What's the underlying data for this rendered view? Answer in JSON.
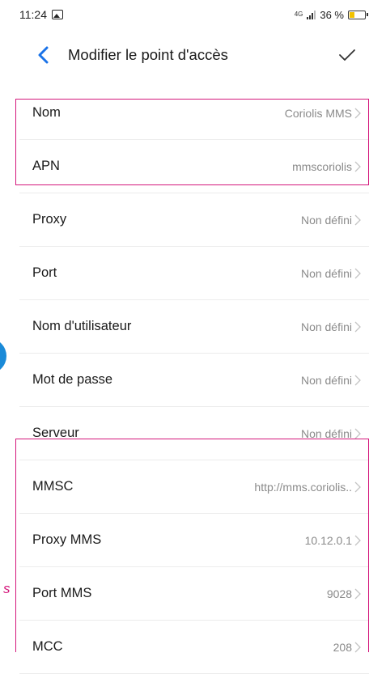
{
  "status_bar": {
    "time": "11:24",
    "network": "4G",
    "battery_percent": "36 %",
    "battery_level": 0.36,
    "battery_color": "#f2c200"
  },
  "header": {
    "back_icon": "chevron-left-icon",
    "title": "Modifier le point d'accès",
    "confirm_icon": "checkmark-icon"
  },
  "rows": [
    {
      "label": "Nom",
      "value": "Coriolis MMS"
    },
    {
      "label": "APN",
      "value": "mmscoriolis"
    },
    {
      "label": "Proxy",
      "value": "Non défini"
    },
    {
      "label": "Port",
      "value": "Non défini"
    },
    {
      "label": "Nom d'utilisateur",
      "value": "Non défini"
    },
    {
      "label": "Mot de passe",
      "value": "Non défini"
    },
    {
      "label": "Serveur",
      "value": "Non défini"
    },
    {
      "label": "MMSC",
      "value": "http://mms.coriolis.."
    },
    {
      "label": "Proxy MMS",
      "value": "10.12.0.1"
    },
    {
      "label": "Port MMS",
      "value": "9028"
    },
    {
      "label": "MCC",
      "value": "208"
    }
  ],
  "annotation": {
    "fragment_text": "s",
    "highlight_color": "#d4177b",
    "side_marker_color": "#1a8ad8"
  },
  "colors": {
    "accent": "#1a73e8",
    "value_text": "#8a8a8a"
  }
}
